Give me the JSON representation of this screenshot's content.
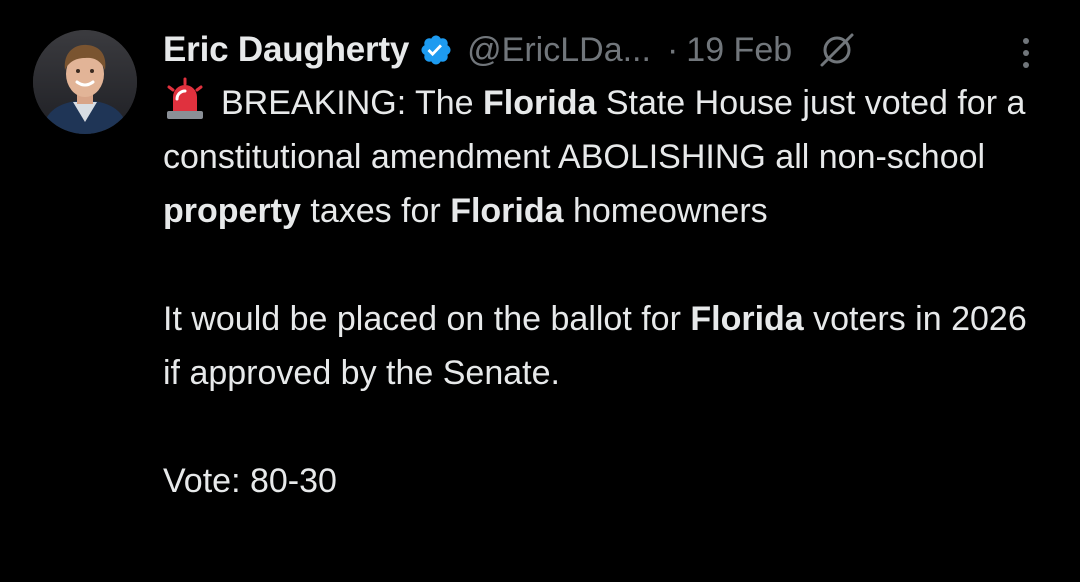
{
  "author": {
    "display_name": "Eric Daugherty",
    "handle": "@EricLDa...",
    "verified_badge": "verified-badge-icon",
    "avatar": "profile-photo"
  },
  "meta": {
    "separator": "·",
    "date": "19 Feb",
    "grok_icon": "grok-slash-icon",
    "more_icon": "more-vertical-icon"
  },
  "colors": {
    "background": "#000000",
    "text_primary": "#e7e9ea",
    "text_secondary": "#71767b",
    "verified_blue": "#1d9bf0",
    "siren_red": "#e0313e"
  },
  "tweet": {
    "emoji": "police-car-light-emoji",
    "p1": {
      "s1": "BREAKING: The ",
      "s2": "Florida",
      "s3": " State House just voted for a constitutional amendment ABOLISHING all non-school ",
      "s4": "property",
      "s5": " taxes for ",
      "s6": "Florida",
      "s7": " homeowners"
    },
    "p2": {
      "s1": "It would be placed on the ballot for ",
      "s2": "Florida",
      "s3": " voters in 2026 if approved by the Senate."
    },
    "p3": {
      "s1": "Vote: 80-30"
    }
  }
}
